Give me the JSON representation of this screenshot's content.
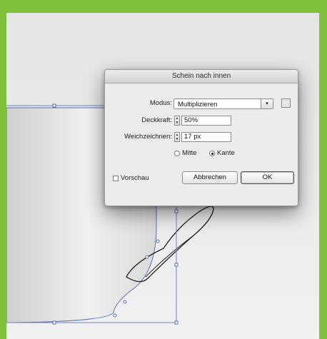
{
  "dialog": {
    "title": "Schein nach innen",
    "mode": {
      "label": "Modus:",
      "value": "Multiplizieren"
    },
    "opacity": {
      "label": "Deckkraft:",
      "value": "50%"
    },
    "blur": {
      "label": "Weichzeichnen:",
      "value": "17 px"
    },
    "source_options": [
      {
        "label": "Mitte",
        "selected": false
      },
      {
        "label": "Kante",
        "selected": true
      }
    ],
    "preview_label": "Vorschau",
    "cancel_label": "Abbrechen",
    "ok_label": "OK"
  },
  "colors": {
    "frame": "#7fc03a",
    "path": "#5a6fb0"
  }
}
